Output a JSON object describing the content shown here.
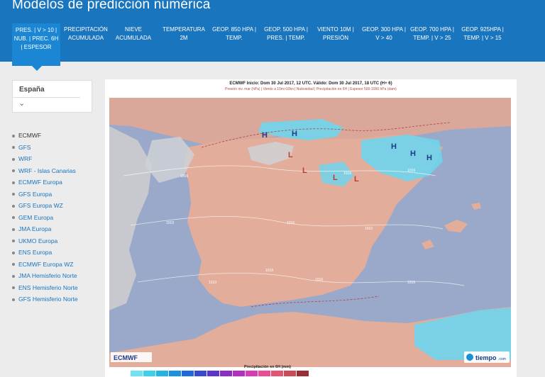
{
  "header": {
    "title": "Modelos de predicción numérica",
    "tabs": [
      {
        "line1": "PRES. | V > 10 |",
        "line2": "NUB. | PREC. 6H",
        "line3": "| ESPESOR"
      },
      {
        "line1": "PRECIPITACIÓN",
        "line2": "ACUMULADA",
        "line3": ""
      },
      {
        "line1": "NIEVE",
        "line2": "ACUMULADA",
        "line3": ""
      },
      {
        "line1": "TEMPERATURA",
        "line2": "2M",
        "line3": ""
      },
      {
        "line1": "GEOP. 850 HPA |",
        "line2": "TEMP.",
        "line3": ""
      },
      {
        "line1": "GEOP. 500 HPA |",
        "line2": "PRES. | TEMP.",
        "line3": ""
      },
      {
        "line1": "VIENTO 10M |",
        "line2": "PRESIÓN",
        "line3": ""
      },
      {
        "line1": "GEOP. 300 HPA |",
        "line2": "V > 40",
        "line3": ""
      },
      {
        "line1": "GEOP. 700 HPA |",
        "line2": "TEMP. | V > 25",
        "line3": ""
      },
      {
        "line1": "GEOP. 925HPA |",
        "line2": "TEMP. | V > 15",
        "line3": ""
      }
    ]
  },
  "sidebar": {
    "region": "España",
    "models": [
      "ECMWF",
      "GFS",
      "WRF",
      "WRF - Islas Canarias",
      "ECMWF Europa",
      "GFS Europa",
      "GFS Europa WZ",
      "GEM Europa",
      "JMA Europa",
      "UKMO Europa",
      "ENS Europa",
      "ECMWF Europa WZ",
      "JMA Hemisferio Norte",
      "ENS Hemisferio Norte",
      "GFS Hemisferio Norte"
    ]
  },
  "map": {
    "title": "ECMWF Inicio: Dom 30 Jul 2017, 12 UTC.   Válido: Dom 30 Jul 2017, 18 UTC (H+ 6)",
    "subtitle": "Presión niv. mar (hPa) | Viento a 10m>10kn | Nubosidad | Precipitación en 6H | Espesor 500-1000 hPa (dam)",
    "logo_left": "ECMWF",
    "logo_right": "tiempo",
    "logo_right_suffix": ".com",
    "isobar_labels": [
      "1016",
      "1016",
      "1016",
      "1016",
      "1010",
      "1010",
      "1010",
      "1016",
      "1016",
      "1016"
    ],
    "pressure_marks": [
      {
        "label": "H"
      },
      {
        "label": "H"
      },
      {
        "label": "H"
      },
      {
        "label": "H"
      },
      {
        "label": "H"
      },
      {
        "label": "L"
      },
      {
        "label": "L"
      },
      {
        "label": "L"
      },
      {
        "label": "L"
      }
    ],
    "legend_title": "Precipitación en 6H (mm)",
    "legend_colors": [
      "#6fe3f2",
      "#3dd0ea",
      "#22b4e6",
      "#1e90e0",
      "#1f6ad8",
      "#3a48cf",
      "#5b35c9",
      "#8a2ec4",
      "#b32fc0",
      "#d83cb2",
      "#ea4d95",
      "#e35472",
      "#c84b57",
      "#9b2d35"
    ]
  }
}
